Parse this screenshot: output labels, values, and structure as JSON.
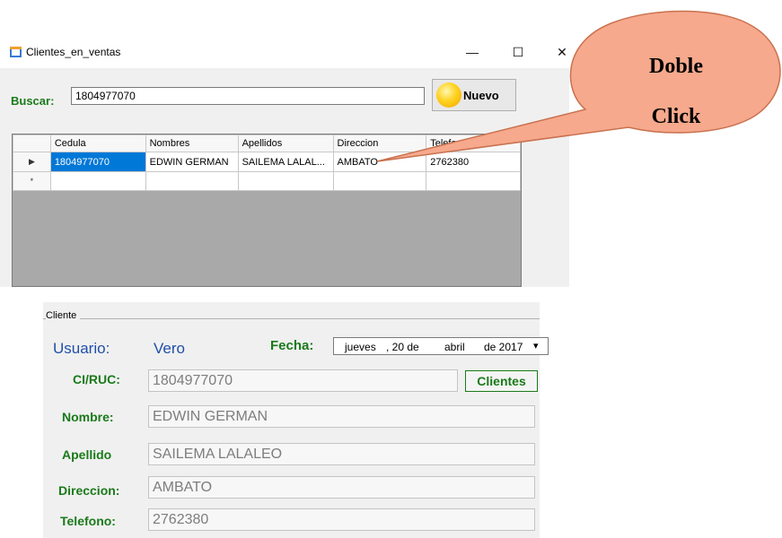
{
  "window": {
    "title": "Clientes_en_ventas",
    "min_glyph": "—",
    "max_glyph": "☐",
    "close_glyph": "✕",
    "icon": "form-icon"
  },
  "search": {
    "label": "Buscar:",
    "value": "1804977070"
  },
  "nuevo_button": {
    "label": "Nuevo",
    "icon": "sun-icon"
  },
  "grid": {
    "columns": [
      "Cedula",
      "Nombres",
      "Apellidos",
      "Direccion",
      "Telefono"
    ],
    "rows": [
      [
        "1804977070",
        "EDWIN GERMAN",
        "SAILEMA LALAL...",
        "AMBATO",
        "2762380"
      ]
    ],
    "current_row_marker": "▶",
    "new_row_marker": "*"
  },
  "callout": {
    "line1": "Doble",
    "line2": "Click",
    "fill_color": "#f6a98c"
  },
  "cliente_panel": {
    "group_label": "Cliente",
    "usuario_label": "Usuario:",
    "usuario_value": "Vero",
    "fecha_label": "Fecha:",
    "fecha": {
      "weekday": "jueves",
      "day": ", 20 de",
      "month": "abril",
      "year": "de 2017"
    },
    "ci_label": "CI/RUC:",
    "ci_value": "1804977070",
    "clientes_button": "Clientes",
    "nombre_label": "Nombre:",
    "nombre_value": "EDWIN GERMAN",
    "apellido_label": "Apellido",
    "apellido_value": "SAILEMA LALALEO",
    "direccion_label": "Direccion:",
    "direccion_value": "AMBATO",
    "telefono_label": "Telefono:",
    "telefono_value": "2762380"
  },
  "colors": {
    "label_green": "#1a7a1a",
    "label_blue": "#1f4fa8",
    "selection_blue": "#0078d7"
  }
}
